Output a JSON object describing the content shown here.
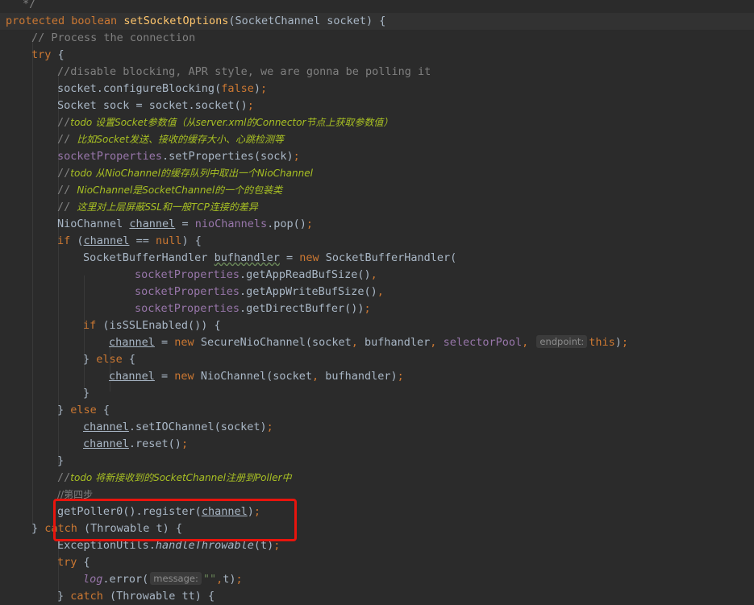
{
  "editor": {
    "colors": {
      "background": "#2b2b2b",
      "keyword": "#cc7832",
      "method": "#ffc66d",
      "comment": "#808080",
      "todo": "#a8c023",
      "field": "#9876aa",
      "string": "#6a8759",
      "annotation_box": "#e8140d"
    },
    "lines": [
      [
        [
          "cm",
          "*/"
        ]
      ],
      [
        [
          "kw",
          "protected boolean "
        ],
        [
          "fn",
          "setSocketOptions"
        ],
        [
          "",
          "(SocketChannel socket) {"
        ]
      ],
      [
        [
          "cm",
          "// Process the connection"
        ]
      ],
      [
        [
          "kw",
          "try "
        ],
        [
          "",
          "{"
        ]
      ],
      [
        [
          "cm",
          "//disable blocking, APR style, we are gonna be polling it"
        ]
      ],
      [
        [
          "",
          "socket.configureBlocking("
        ],
        [
          "kw",
          "false"
        ],
        [
          "",
          ")"
        ],
        [
          "kw",
          ";"
        ]
      ],
      [
        [
          "",
          "Socket sock = socket.socket()"
        ],
        [
          "kw",
          ";"
        ]
      ],
      [
        [
          "cm",
          "//"
        ],
        [
          "todo",
          "todo 设置Socket参数值（从server.xml的Connector节点上获取参数值）"
        ]
      ],
      [
        [
          "cm",
          "// "
        ],
        [
          "todo",
          "比如Socket发送、接收的缓存大小、心跳检测等"
        ]
      ],
      [
        [
          "fld",
          "socketProperties"
        ],
        [
          "",
          ".setProperties(sock)"
        ],
        [
          "kw",
          ";"
        ]
      ],
      [
        [
          "cm",
          "//"
        ],
        [
          "todo",
          "todo 从NioChannel的缓存队列中取出一个NioChannel"
        ]
      ],
      [
        [
          "cm",
          "// "
        ],
        [
          "todo",
          "NioChannel是SocketChannel的一个的包装类"
        ]
      ],
      [
        [
          "cm",
          "// "
        ],
        [
          "todo",
          "这里对上层屏蔽SSL和一般TCP连接的差异"
        ]
      ],
      [
        [
          "",
          "NioChannel "
        ],
        [
          "ul",
          "channel"
        ],
        [
          "",
          " = "
        ],
        [
          "fld",
          "nioChannels"
        ],
        [
          "",
          ".pop()"
        ],
        [
          "kw",
          ";"
        ]
      ],
      [
        [
          "kw",
          "if "
        ],
        [
          "",
          "("
        ],
        [
          "ul",
          "channel"
        ],
        [
          "",
          " == "
        ],
        [
          "kw",
          "null"
        ],
        [
          "",
          ") {"
        ]
      ],
      [
        [
          "",
          "SocketBufferHandler "
        ],
        [
          "wavy",
          "bufhandler"
        ],
        [
          "",
          " = "
        ],
        [
          "kw",
          "new "
        ],
        [
          "",
          "SocketBufferHandler("
        ]
      ],
      [
        [
          "fld",
          "socketProperties"
        ],
        [
          "",
          ".getAppReadBufSize()"
        ],
        [
          "kw",
          ","
        ]
      ],
      [
        [
          "fld",
          "socketProperties"
        ],
        [
          "",
          ".getAppWriteBufSize()"
        ],
        [
          "kw",
          ","
        ]
      ],
      [
        [
          "fld",
          "socketProperties"
        ],
        [
          "",
          ".getDirectBuffer())"
        ],
        [
          "kw",
          ";"
        ]
      ],
      [
        [
          "kw",
          "if "
        ],
        [
          "",
          "(isSSLEnabled()) {"
        ]
      ],
      [
        [
          "ul",
          "channel"
        ],
        [
          "",
          " = "
        ],
        [
          "kw",
          "new "
        ],
        [
          "",
          "SecureNioChannel(socket"
        ],
        [
          "kw",
          ", "
        ],
        [
          "",
          "bufhandler"
        ],
        [
          "kw",
          ", "
        ],
        [
          "fld",
          "selectorPool"
        ],
        [
          "kw",
          ", "
        ],
        [
          "hint",
          "endpoint:"
        ],
        [
          "kw",
          "this"
        ],
        [
          "",
          ")"
        ],
        [
          "kw",
          ";"
        ]
      ],
      [
        [
          "",
          "} "
        ],
        [
          "kw",
          "else "
        ],
        [
          "",
          "{"
        ]
      ],
      [
        [
          "ul",
          "channel"
        ],
        [
          "",
          " = "
        ],
        [
          "kw",
          "new "
        ],
        [
          "",
          "NioChannel(socket"
        ],
        [
          "kw",
          ", "
        ],
        [
          "",
          "bufhandler)"
        ],
        [
          "kw",
          ";"
        ]
      ],
      [
        [
          "",
          "}"
        ]
      ],
      [
        [
          "",
          "} "
        ],
        [
          "kw",
          "else "
        ],
        [
          "",
          "{"
        ]
      ],
      [
        [
          "ul",
          "channel"
        ],
        [
          "",
          ".setIOChannel(socket)"
        ],
        [
          "kw",
          ";"
        ]
      ],
      [
        [
          "ul",
          "channel"
        ],
        [
          "",
          ".reset()"
        ],
        [
          "kw",
          ";"
        ]
      ],
      [
        [
          "",
          "}"
        ]
      ],
      [
        [
          "cm",
          "//"
        ],
        [
          "todo",
          "todo 将新接收到的SocketChannel注册到Poller中"
        ]
      ],
      [
        [
          "cm",
          "//第四步"
        ]
      ],
      [
        [
          "",
          "getPoller0().register("
        ],
        [
          "ul",
          "channel"
        ],
        [
          "",
          ")"
        ],
        [
          "kw",
          ";"
        ]
      ],
      [
        [
          "",
          "} "
        ],
        [
          "kw",
          "catch "
        ],
        [
          "",
          "(Throwable t) {"
        ]
      ],
      [
        [
          "",
          "ExceptionUtils."
        ],
        [
          "st",
          "handleThrowable"
        ],
        [
          "",
          "(t)"
        ],
        [
          "kw",
          ";"
        ]
      ],
      [
        [
          "kw",
          "try "
        ],
        [
          "",
          "{"
        ]
      ],
      [
        [
          "fld st",
          "log"
        ],
        [
          "",
          ".error("
        ],
        [
          "hint",
          "message:"
        ],
        [
          "str",
          "\"\""
        ],
        [
          "kw",
          ","
        ],
        [
          "",
          "t)"
        ],
        [
          "kw",
          ";"
        ]
      ],
      [
        [
          "",
          "} "
        ],
        [
          "kw",
          "catch "
        ],
        [
          "",
          "(Throwable tt) {"
        ]
      ]
    ]
  }
}
